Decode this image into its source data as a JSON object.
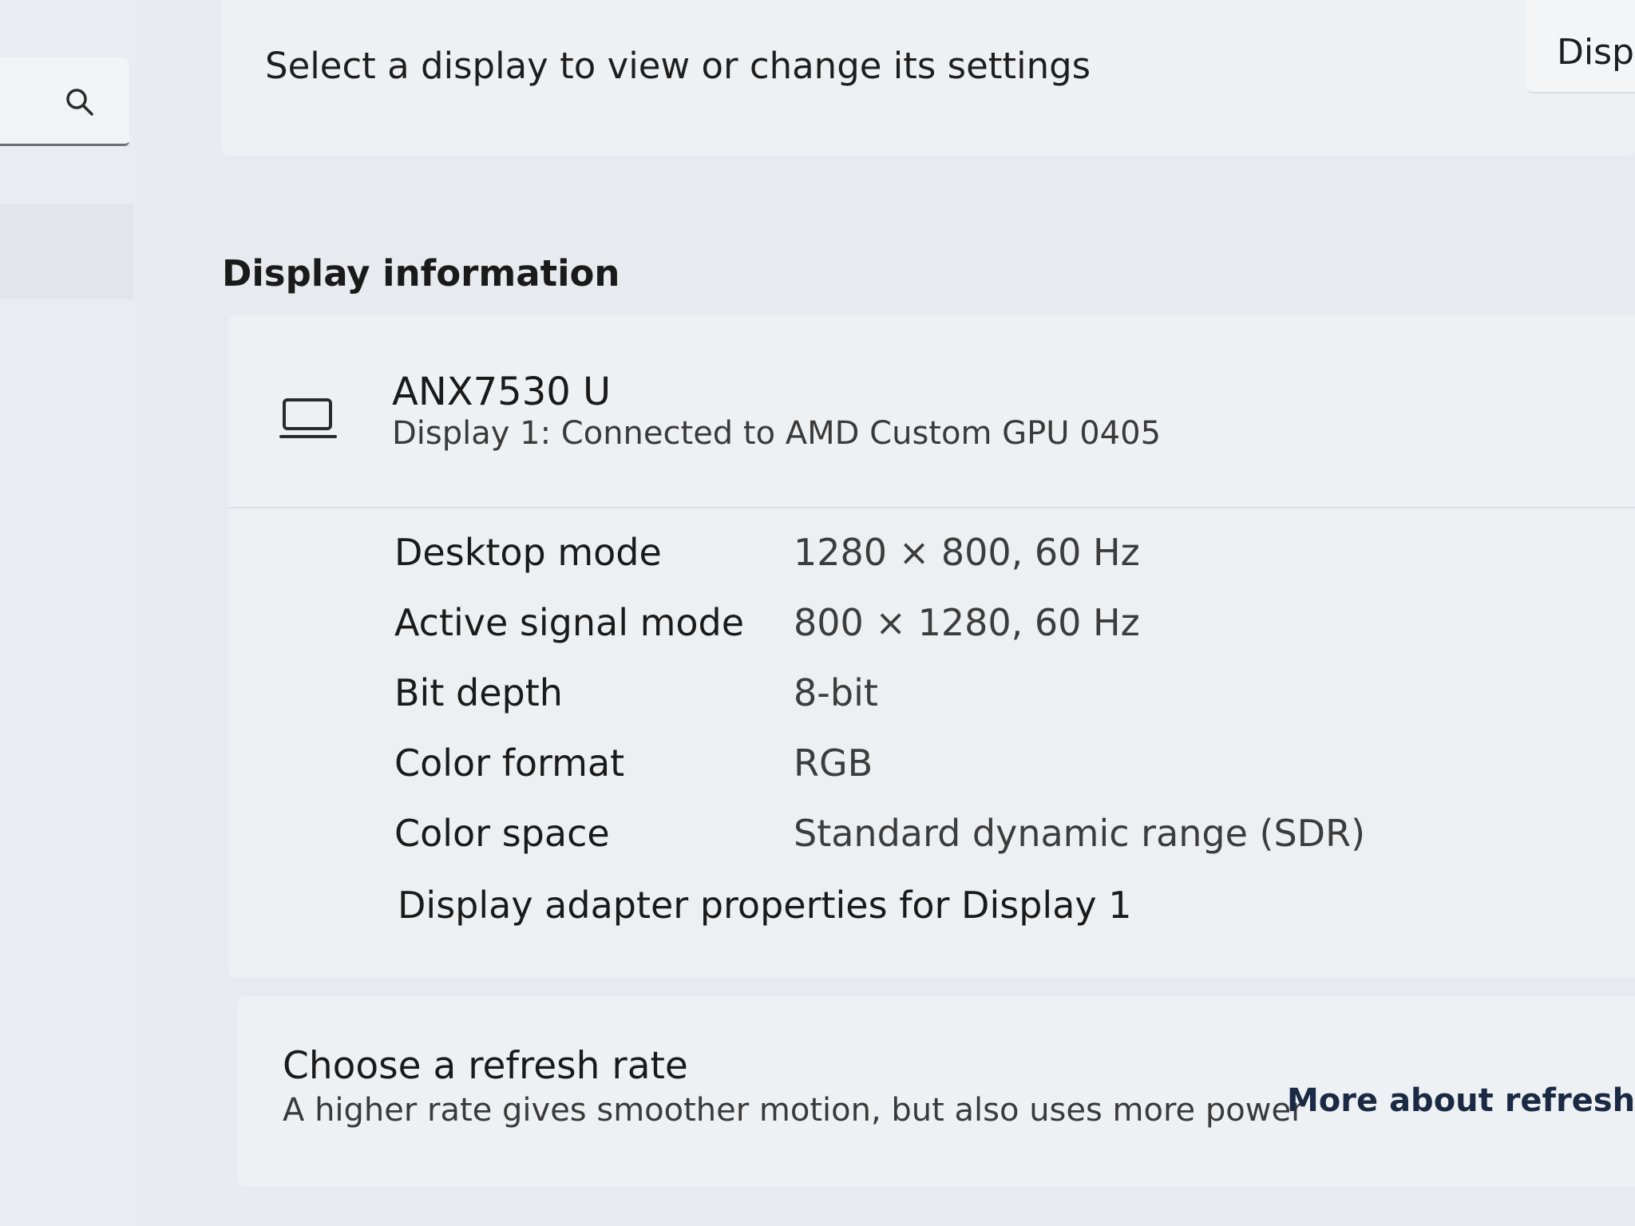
{
  "search": {
    "icon": "search-icon"
  },
  "header": {
    "select_display_text": "Select a display to view or change its settings",
    "top_right_button_label": "Displ"
  },
  "display_info": {
    "heading": "Display information",
    "device_icon": "laptop-icon",
    "device_name": "ANX7530 U",
    "device_connection": "Display 1: Connected to AMD Custom GPU 0405",
    "properties": [
      {
        "label": "Desktop mode",
        "value": "1280 × 800, 60 Hz"
      },
      {
        "label": "Active signal mode",
        "value": "800 × 1280, 60 Hz"
      },
      {
        "label": "Bit depth",
        "value": "8-bit"
      },
      {
        "label": "Color format",
        "value": "RGB"
      },
      {
        "label": "Color space",
        "value": "Standard dynamic range (SDR)"
      }
    ],
    "adapter_link": "Display adapter properties for Display 1"
  },
  "refresh_rate": {
    "title": "Choose a refresh rate",
    "description": "A higher rate gives smoother motion, but also uses more power",
    "link": "More about refresh rat"
  }
}
